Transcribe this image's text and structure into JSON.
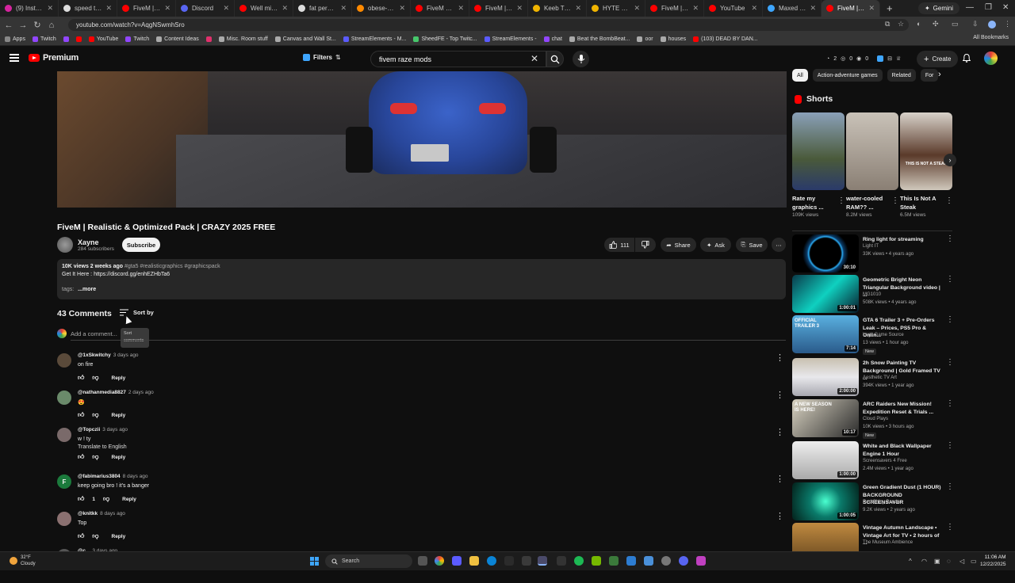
{
  "browser": {
    "tabs": [
      {
        "label": "(9) Instagram",
        "color": "#d6249f"
      },
      {
        "label": "speed test - G",
        "color": "#dddddd"
      },
      {
        "label": "FiveM | ULTIM",
        "color": "#ff0000"
      },
      {
        "label": "Discord",
        "color": "#5865f2"
      },
      {
        "label": "Well mistakes",
        "color": "#ff0000"
      },
      {
        "label": "fat person - G",
        "color": "#dddddd"
      },
      {
        "label": "obese-man-sit",
        "color": "#ff8a00"
      },
      {
        "label": "FiveM - INSAN",
        "color": "#ff0000"
      },
      {
        "label": "FiveM | ULTIM",
        "color": "#ff0000"
      },
      {
        "label": "Keeb TKL Key",
        "color": "#f0b400"
      },
      {
        "label": "HYTE Release",
        "color": "#f0b400"
      },
      {
        "label": "FiveM | TOP-T",
        "color": "#ff0000"
      },
      {
        "label": "YouTube",
        "color": "#ff0000"
      },
      {
        "label": "Maxed Realist",
        "color": "#3ea6ff"
      },
      {
        "label": "FiveM | Realis",
        "color": "#ff0000",
        "active": true
      }
    ],
    "gemini_label": "Gemini",
    "url": "youtube.com/watch?v=AqgNSwmhSro",
    "bookmarks": [
      {
        "label": "Apps",
        "color": "#888888"
      },
      {
        "label": "Twitch",
        "color": "#9146ff"
      },
      {
        "label": "",
        "color": "#9146ff"
      },
      {
        "label": "",
        "color": "#ff0000"
      },
      {
        "label": "YouTube",
        "color": "#ff0000"
      },
      {
        "label": "Twitch",
        "color": "#9146ff"
      },
      {
        "label": "Content Ideas",
        "color": "#aaaaaa"
      },
      {
        "label": "",
        "color": "#e1306c"
      },
      {
        "label": "Misc. Room stuff",
        "color": "#aaaaaa"
      },
      {
        "label": "Canvas and Wall St...",
        "color": "#aaaaaa"
      },
      {
        "label": "StreamElements - M...",
        "color": "#5b5bff"
      },
      {
        "label": "SheedFE - Top Twitc...",
        "color": "#47c76b"
      },
      {
        "label": "StreamElements -",
        "color": "#5b5bff"
      },
      {
        "label": "chat",
        "color": "#9146ff"
      },
      {
        "label": "Beat the BombBeat...",
        "color": "#aaaaaa"
      },
      {
        "label": "oor",
        "color": "#aaaaaa"
      },
      {
        "label": "houses",
        "color": "#aaaaaa"
      },
      {
        "label": "(103) DEAD BY DAN...",
        "color": "#ff0000"
      }
    ],
    "all_bookmarks": "All Bookmarks"
  },
  "header": {
    "logo_text": "Premium",
    "filters_label": "Filters",
    "search_value": "fivem raze mods",
    "stats": [
      "2",
      "0",
      "0"
    ],
    "create_label": "Create"
  },
  "video": {
    "title": "FiveM | Realistic & Optimized Pack | CRAZY 2025 FREE",
    "channel": "Xayne",
    "subscribers": "284 subscribers",
    "subscribe_label": "Subscribe",
    "likes": "111",
    "share_label": "Share",
    "ask_label": "Ask",
    "save_label": "Save",
    "views_time": "10K views  2 weeks ago",
    "hashtags": "#gta5 #realisticgraphics #graphicspack",
    "desc_line": "Get It Here :  https://discord.gg/enhEZHbTa6",
    "desc_tags": "tags:",
    "more_label": "...more"
  },
  "comments": {
    "count_label": "43 Comments",
    "sort_label": "Sort by",
    "sort_tooltip_1": "Sort",
    "sort_tooltip_2": "comments",
    "add_placeholder": "Add a comment...",
    "reply_label": "Reply",
    "items": [
      {
        "user": "@1xSkwitchy",
        "date": "3 days ago",
        "text": "on fire",
        "likes": "",
        "avatar": "#5a4a3a"
      },
      {
        "user": "@nathanmedia8827",
        "date": "2 days ago",
        "text": "😍",
        "likes": "",
        "avatar": "#6a8a6a"
      },
      {
        "user": "@Topczii",
        "date": "3 days ago",
        "text": "w ! ty",
        "translate": "Translate to English",
        "likes": "",
        "avatar": "#7a6a6a"
      },
      {
        "user": "@fabimarius3804",
        "date": "8 days ago",
        "text": "keep going bro ! it's a banger",
        "likes": "1",
        "avatar": "#1b7a3c",
        "initial": "F"
      },
      {
        "user": "@knitkk",
        "date": "8 days ago",
        "text": "Top",
        "likes": "",
        "avatar": "#8a7070"
      },
      {
        "user": "@c...",
        "date": "3 days ago",
        "text": "",
        "likes": "",
        "avatar": "#555555"
      }
    ]
  },
  "sidebar": {
    "chips": [
      "All",
      "Action-adventure games",
      "Related",
      "For"
    ],
    "shorts_title": "Shorts",
    "shorts": [
      {
        "title": "Rate my graphics ...",
        "views": "109K views"
      },
      {
        "title": "water-cooled RAM?? ...",
        "views": "8.2M views"
      },
      {
        "title": "This Is Not A Steak",
        "views": "6.5M views",
        "thumb_text": "THIS IS NOT A STEAK"
      }
    ],
    "recommended": [
      {
        "title": "Ring light for streaming",
        "channel": "Light IT",
        "meta": "33K views • 4 years ago",
        "duration": "30:10",
        "new": ""
      },
      {
        "title": "Geometric Bright Neon Triangular Background video | ...",
        "channel": "MG1010",
        "meta": "508K views • 4 years ago",
        "duration": "1:00:01",
        "new": ""
      },
      {
        "title": "GTA 6 Trailer 3 + Pre-Orders Leak – Prices, PS5 Pro & Onlin...",
        "channel": "Legit Game Source",
        "meta": "13 views • 1 hour ago",
        "duration": "7:14",
        "new": "New",
        "thumb_text": "OFFICIAL TRAILER 3"
      },
      {
        "title": "2h Snow Painting TV Background | Gold Framed TV ...",
        "channel": "Aesthetic TV Art",
        "meta": "394K views • 1 year ago",
        "duration": "2:00:00",
        "new": ""
      },
      {
        "title": "ARC Raiders New Mission! Expedition Reset & Trials ...",
        "channel": "Cloud Plays",
        "meta": "10K views • 3 hours ago",
        "duration": "10:17",
        "new": "New",
        "thumb_text": "A NEW SEASON IS HERE!"
      },
      {
        "title": "White and Black Wallpaper Engine 1 Hour",
        "channel": "Screensavers 4 Free",
        "meta": "2.4M views • 1 year ago",
        "duration": "1:00:00",
        "new": ""
      },
      {
        "title": "Green Gradient Dust (1 HOUR) BACKGROUND SCREENSAVER",
        "channel": "Red Shiny Panda",
        "meta": "9.2K views • 2 years ago",
        "duration": "1:00:05",
        "new": ""
      },
      {
        "title": "Vintage Autumn Landscape • Vintage Art for TV • 2 hours of ...",
        "channel": "The Museum Ambience",
        "meta": "",
        "duration": "",
        "new": ""
      }
    ]
  },
  "taskbar": {
    "temp": "32°F",
    "condition": "Cloudy",
    "search_label": "Search",
    "time": "11:06 AM",
    "date": "12/22/2025"
  }
}
